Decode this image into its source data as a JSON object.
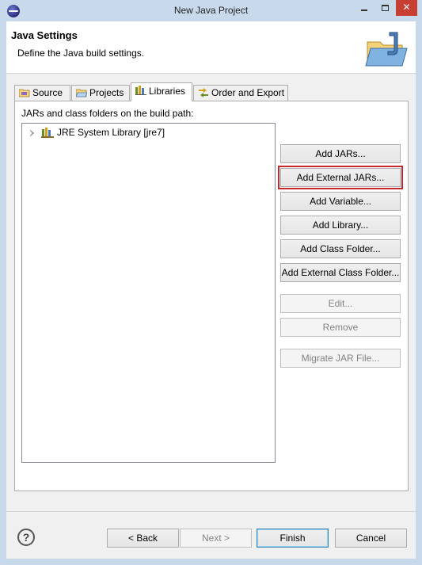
{
  "window": {
    "title": "New Java Project"
  },
  "banner": {
    "title": "Java Settings",
    "description": "Define the Java build settings."
  },
  "tabs": [
    {
      "label": "Source",
      "icon": "source-folder-icon",
      "active": false
    },
    {
      "label": "Projects",
      "icon": "projects-icon",
      "active": false
    },
    {
      "label": "Libraries",
      "icon": "libraries-icon",
      "active": true
    },
    {
      "label": "Order and Export",
      "icon": "order-export-icon",
      "active": false
    }
  ],
  "libraries_panel": {
    "label": "JARs and class folders on the build path:",
    "tree_items": [
      {
        "label": "JRE System Library [jre7]",
        "icon": "library-icon",
        "expanded": false
      }
    ],
    "buttons": [
      {
        "label": "Add JARs...",
        "enabled": true
      },
      {
        "label": "Add External JARs...",
        "enabled": true,
        "highlighted": true
      },
      {
        "label": "Add Variable...",
        "enabled": true
      },
      {
        "label": "Add Library...",
        "enabled": true
      },
      {
        "label": "Add Class Folder...",
        "enabled": true
      },
      {
        "label": "Add External Class Folder...",
        "enabled": true
      },
      {
        "label": "Edit...",
        "enabled": false
      },
      {
        "label": "Remove",
        "enabled": false
      },
      {
        "label": "Migrate JAR File...",
        "enabled": false
      }
    ]
  },
  "footer": {
    "help_symbol": "?",
    "back_label": "< Back",
    "next_label": "Next >",
    "finish_label": "Finish",
    "cancel_label": "Cancel"
  },
  "colors": {
    "window_frame": "#c8d9ec",
    "close_button": "#c73e32",
    "highlight_outline": "#c6272c"
  }
}
